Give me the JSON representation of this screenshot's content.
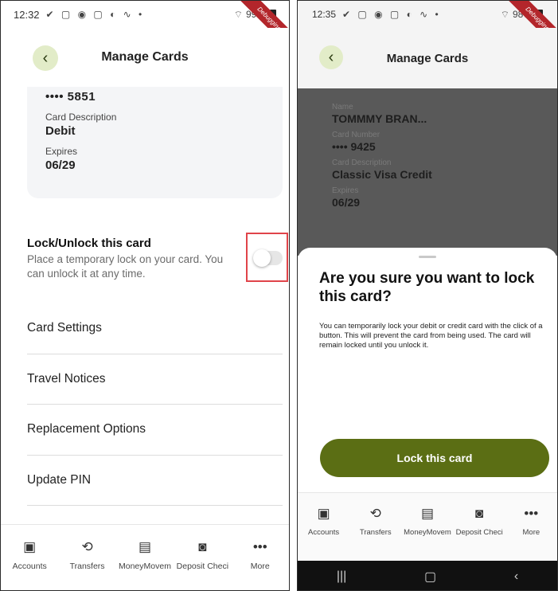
{
  "left": {
    "status": {
      "time": "12:32",
      "battery": "99%",
      "ribbon": "Debugging"
    },
    "header": {
      "title": "Manage Cards"
    },
    "card": {
      "number_partial": "•••• 5851",
      "description_label": "Card Description",
      "description_value": "Debit",
      "expires_label": "Expires",
      "expires_value": "06/29"
    },
    "lock": {
      "title": "Lock/Unlock this card",
      "description": "Place a temporary lock on your card. You can unlock it at any time.",
      "toggle_on": false
    },
    "menu": [
      "Card Settings",
      "Travel Notices",
      "Replacement Options",
      "Update PIN"
    ]
  },
  "right": {
    "status": {
      "time": "12:35",
      "battery": "98%",
      "ribbon": "Debugging"
    },
    "header": {
      "title": "Manage Cards"
    },
    "card": {
      "name_label": "Name",
      "name_value": "TOMMMY BRAN...",
      "number_label": "Card Number",
      "number_value": "•••• 9425",
      "description_label": "Card Description",
      "description_value": "Classic Visa Credit",
      "expires_label": "Expires",
      "expires_value": "06/29"
    },
    "sheet": {
      "title": "Are you sure you want to lock this card?",
      "body": "You can temporarily lock your debit or credit card with the click of a button. This will prevent the card from being used. The card will remain locked until you unlock it.",
      "button": "Lock this card"
    }
  },
  "nav": [
    "Accounts",
    "Transfers",
    "MoneyMovem",
    "Deposit Checi",
    "More"
  ],
  "nav_icons": [
    "accounts-icon",
    "transfers-icon",
    "money-movement-icon",
    "deposit-check-icon",
    "more-icon"
  ],
  "colors": {
    "accent": "#5b6e14",
    "back_button_bg": "#e2ecc8",
    "highlight": "#e0444a",
    "ribbon": "#b3262b"
  }
}
